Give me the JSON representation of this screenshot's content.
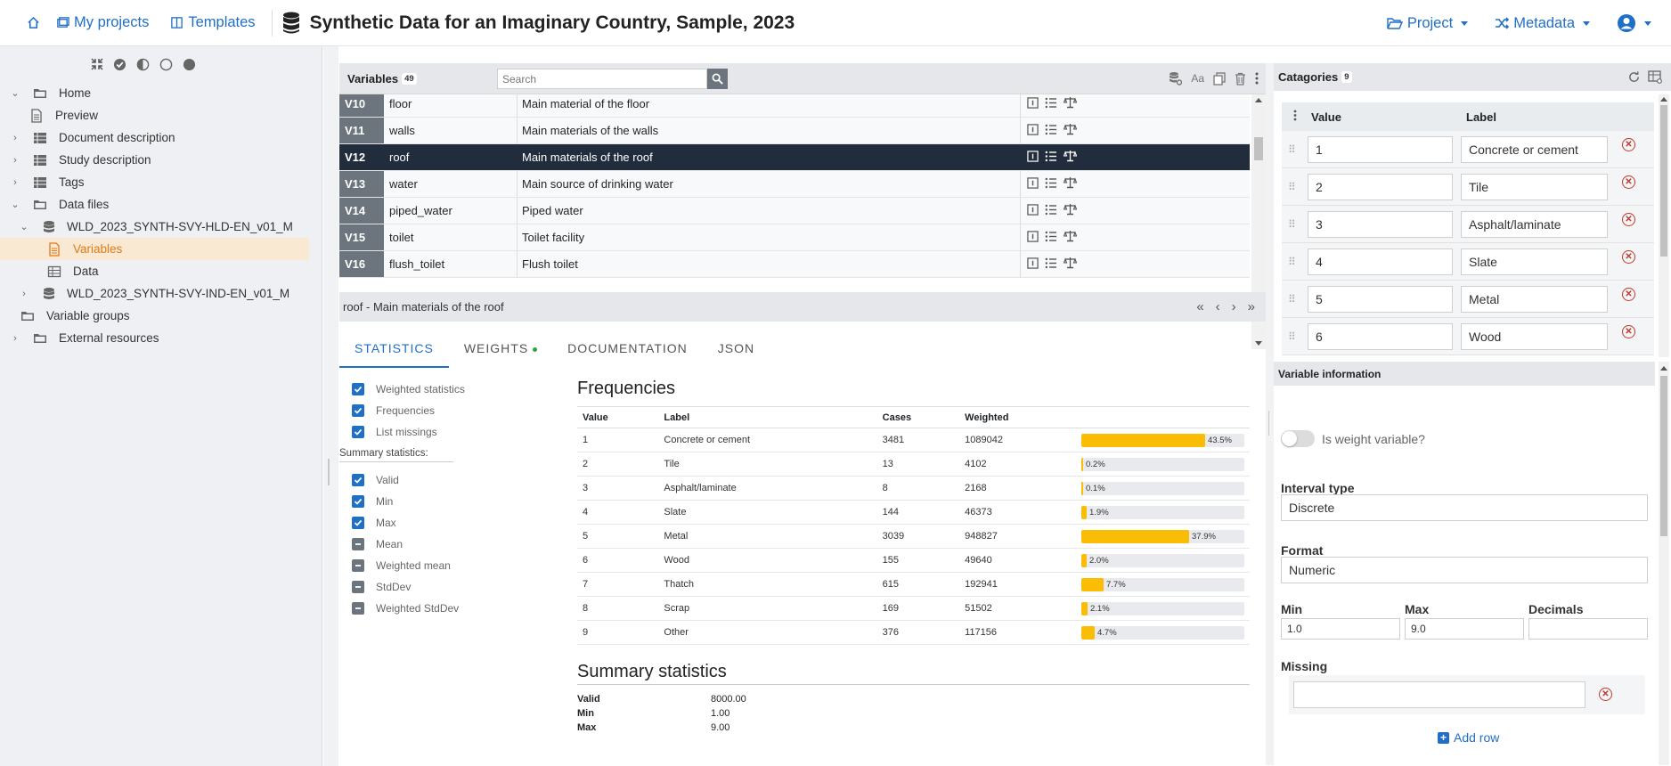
{
  "nav": {
    "my_projects": "My projects",
    "templates": "Templates",
    "title": "Synthetic Data for an Imaginary Country, Sample, 2023",
    "project": "Project",
    "metadata": "Metadata"
  },
  "sidebar": {
    "items": [
      {
        "label": "Home",
        "icon": "folder-icon",
        "expanded": true
      },
      {
        "label": "Preview",
        "icon": "file-icon"
      },
      {
        "label": "Document description",
        "icon": "table-icon",
        "collapsed": true
      },
      {
        "label": "Study description",
        "icon": "table-icon",
        "collapsed": true
      },
      {
        "label": "Tags",
        "icon": "table-icon",
        "collapsed": true
      },
      {
        "label": "Data files",
        "icon": "folder-icon",
        "expanded": true
      },
      {
        "label": "WLD_2023_SYNTH-SVY-HLD-EN_v01_M",
        "icon": "database-icon",
        "expanded": true
      },
      {
        "label": "Variables",
        "icon": "file-icon",
        "active": true
      },
      {
        "label": "Data",
        "icon": "grid-icon"
      },
      {
        "label": "WLD_2023_SYNTH-SVY-IND-EN_v01_M",
        "icon": "database-icon",
        "collapsed": true
      },
      {
        "label": "Variable groups",
        "icon": "folder-icon"
      },
      {
        "label": "External resources",
        "icon": "folder-icon",
        "collapsed": true
      }
    ]
  },
  "variables": {
    "title": "Variables",
    "count": "49",
    "search_placeholder": "Search",
    "rows": [
      {
        "id": "V10",
        "name": "floor",
        "label": "Main material of the floor"
      },
      {
        "id": "V11",
        "name": "walls",
        "label": "Main materials of the walls"
      },
      {
        "id": "V12",
        "name": "roof",
        "label": "Main materials of the roof",
        "selected": true
      },
      {
        "id": "V13",
        "name": "water",
        "label": "Main source of drinking water"
      },
      {
        "id": "V14",
        "name": "piped_water",
        "label": "Piped water"
      },
      {
        "id": "V15",
        "name": "toilet",
        "label": "Toilet facility"
      },
      {
        "id": "V16",
        "name": "flush_toilet",
        "label": "Flush toilet"
      }
    ]
  },
  "detail": {
    "title": "roof - Main materials of the roof"
  },
  "tabs": [
    "STATISTICS",
    "WEIGHTS",
    "DOCUMENTATION",
    "JSON"
  ],
  "options": {
    "main": [
      {
        "label": "Weighted statistics",
        "checked": true
      },
      {
        "label": "Frequencies",
        "checked": true
      },
      {
        "label": "List missings",
        "checked": true
      }
    ],
    "summary_title": "Summary statistics:",
    "summary": [
      {
        "label": "Valid",
        "checked": true
      },
      {
        "label": "Min",
        "checked": true
      },
      {
        "label": "Max",
        "checked": true
      },
      {
        "label": "Mean",
        "checked": false
      },
      {
        "label": "Weighted mean",
        "checked": false
      },
      {
        "label": "StdDev",
        "checked": false
      },
      {
        "label": "Weighted StdDev",
        "checked": false
      }
    ]
  },
  "frequencies": {
    "title": "Frequencies",
    "headers": [
      "Value",
      "Label",
      "Cases",
      "Weighted"
    ],
    "rows": [
      {
        "value": "1",
        "label": "Concrete or cement",
        "cases": "3481",
        "weighted": "1089042",
        "pct": 43.5,
        "pct_label": "43.5%"
      },
      {
        "value": "2",
        "label": "Tile",
        "cases": "13",
        "weighted": "4102",
        "pct": 0.2,
        "pct_label": "0.2%"
      },
      {
        "value": "3",
        "label": "Asphalt/laminate",
        "cases": "8",
        "weighted": "2168",
        "pct": 0.1,
        "pct_label": "0.1%"
      },
      {
        "value": "4",
        "label": "Slate",
        "cases": "144",
        "weighted": "46373",
        "pct": 1.9,
        "pct_label": "1.9%"
      },
      {
        "value": "5",
        "label": "Metal",
        "cases": "3039",
        "weighted": "948827",
        "pct": 37.9,
        "pct_label": "37.9%"
      },
      {
        "value": "6",
        "label": "Wood",
        "cases": "155",
        "weighted": "49640",
        "pct": 2.0,
        "pct_label": "2.0%"
      },
      {
        "value": "7",
        "label": "Thatch",
        "cases": "615",
        "weighted": "192941",
        "pct": 7.7,
        "pct_label": "7.7%"
      },
      {
        "value": "8",
        "label": "Scrap",
        "cases": "169",
        "weighted": "51502",
        "pct": 2.1,
        "pct_label": "2.1%"
      },
      {
        "value": "9",
        "label": "Other",
        "cases": "376",
        "weighted": "117156",
        "pct": 4.7,
        "pct_label": "4.7%"
      }
    ]
  },
  "summary_stats": {
    "title": "Summary statistics",
    "rows": [
      {
        "key": "Valid",
        "value": "8000.00"
      },
      {
        "key": "Min",
        "value": "1.00"
      },
      {
        "key": "Max",
        "value": "9.00"
      }
    ]
  },
  "categories": {
    "title": "Catagories",
    "count": "9",
    "value_header": "Value",
    "label_header": "Label",
    "rows": [
      {
        "value": "1",
        "label": "Concrete or cement"
      },
      {
        "value": "2",
        "label": "Tile"
      },
      {
        "value": "3",
        "label": "Asphalt/laminate"
      },
      {
        "value": "4",
        "label": "Slate"
      },
      {
        "value": "5",
        "label": "Metal"
      },
      {
        "value": "6",
        "label": "Wood"
      }
    ]
  },
  "var_info": {
    "title": "Variable information",
    "weight_toggle_label": "Is weight variable?",
    "weight_on": false,
    "interval_label": "Interval type",
    "interval_value": "Discrete",
    "format_label": "Format",
    "format_value": "Numeric",
    "min_label": "Min",
    "min_value": "1.0",
    "max_label": "Max",
    "max_value": "9.0",
    "decimals_label": "Decimals",
    "decimals_value": "",
    "missing_label": "Missing",
    "missing_value": "",
    "add_row": "Add row"
  },
  "colors": {
    "accent": "#1f6fc5",
    "selected_row": "#212d3d",
    "bar_fill": "#fbbc05",
    "active_sidebar": "#e07a1a"
  }
}
